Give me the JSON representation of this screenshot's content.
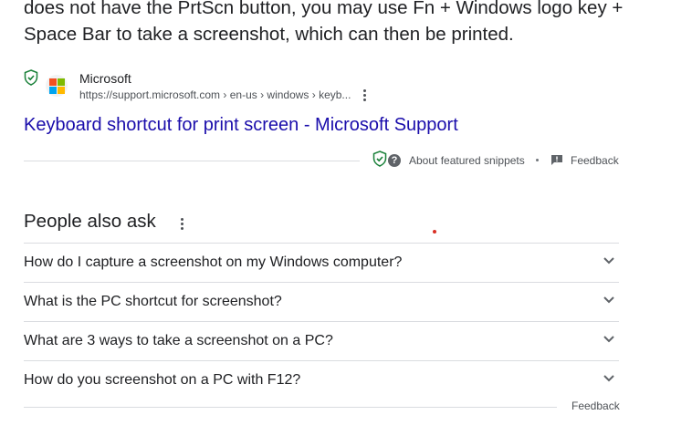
{
  "snippet": {
    "text": "does not have the PrtScn button, you may use Fn + Windows logo key + Space Bar to take a screenshot, which can then be printed."
  },
  "source": {
    "site_name": "Microsoft",
    "url": "https://support.microsoft.com › en-us › windows › keyb..."
  },
  "result": {
    "title": "Keyboard shortcut for print screen - Microsoft Support"
  },
  "snippet_meta": {
    "about_label": "About featured snippets",
    "separator": "•",
    "feedback_label": "Feedback"
  },
  "paa": {
    "title": "People also ask",
    "questions": [
      "How do I capture a screenshot on my Windows computer?",
      "What is the PC shortcut for screenshot?",
      "What are 3 ways to take a screenshot on a PC?",
      "How do you screenshot on a PC with F12?"
    ],
    "feedback_label": "Feedback"
  },
  "colors": {
    "link": "#1a0dab",
    "shield_green": "#188038",
    "ms_red": "#f25022",
    "ms_green": "#7fba00",
    "ms_blue": "#00a4ef",
    "ms_yellow": "#ffb900"
  }
}
